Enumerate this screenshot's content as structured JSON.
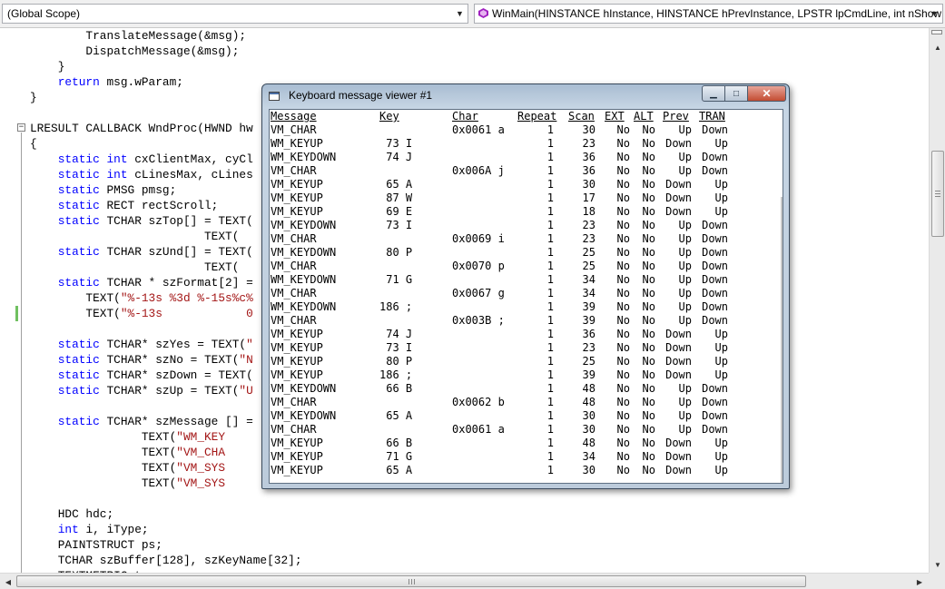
{
  "scope_bar": {
    "scope": "(Global Scope)",
    "function": "WinMain(HINSTANCE hInstance, HINSTANCE hPrevInstance, LPSTR lpCmdLine, int nShow"
  },
  "code_lines": [
    [
      {
        "t": "        TranslateMessage(&msg);"
      }
    ],
    [
      {
        "t": "        DispatchMessage(&msg);"
      }
    ],
    [
      {
        "t": "    }"
      }
    ],
    [
      {
        "t": "    "
      },
      {
        "t": "return",
        "c": "kw"
      },
      {
        "t": " msg.wParam;"
      }
    ],
    [
      {
        "t": "}"
      }
    ],
    [
      {
        "t": ""
      }
    ],
    [
      {
        "t": "LRESULT CALLBACK WndProc(HWND hw"
      }
    ],
    [
      {
        "t": "{"
      }
    ],
    [
      {
        "t": "    "
      },
      {
        "t": "static",
        "c": "kw"
      },
      {
        "t": " "
      },
      {
        "t": "int",
        "c": "kw"
      },
      {
        "t": " cxClientMax, cyCl"
      }
    ],
    [
      {
        "t": "    "
      },
      {
        "t": "static",
        "c": "kw"
      },
      {
        "t": " "
      },
      {
        "t": "int",
        "c": "kw"
      },
      {
        "t": " cLinesMax, cLines"
      }
    ],
    [
      {
        "t": "    "
      },
      {
        "t": "static",
        "c": "kw"
      },
      {
        "t": " PMSG pmsg;"
      }
    ],
    [
      {
        "t": "    "
      },
      {
        "t": "static",
        "c": "kw"
      },
      {
        "t": " RECT rectScroll;"
      }
    ],
    [
      {
        "t": "    "
      },
      {
        "t": "static",
        "c": "kw"
      },
      {
        "t": " TCHAR szTop[] = TEXT("
      }
    ],
    [
      {
        "t": "                         TEXT("
      }
    ],
    [
      {
        "t": "    "
      },
      {
        "t": "static",
        "c": "kw"
      },
      {
        "t": " TCHAR szUnd[] = TEXT("
      }
    ],
    [
      {
        "t": "                         TEXT("
      }
    ],
    [
      {
        "t": "    "
      },
      {
        "t": "static",
        "c": "kw"
      },
      {
        "t": " TCHAR * szFormat[2] ="
      }
    ],
    [
      {
        "t": "        TEXT("
      },
      {
        "t": "\"%-13s %3d %-15s%c%",
        "c": "str"
      }
    ],
    [
      {
        "t": "        TEXT("
      },
      {
        "t": "\"%-13s            0",
        "c": "str"
      }
    ],
    [
      {
        "t": ""
      }
    ],
    [
      {
        "t": "    "
      },
      {
        "t": "static",
        "c": "kw"
      },
      {
        "t": " TCHAR* szYes = TEXT("
      },
      {
        "t": "\"",
        "c": "str"
      }
    ],
    [
      {
        "t": "    "
      },
      {
        "t": "static",
        "c": "kw"
      },
      {
        "t": " TCHAR* szNo = TEXT("
      },
      {
        "t": "\"N",
        "c": "str"
      }
    ],
    [
      {
        "t": "    "
      },
      {
        "t": "static",
        "c": "kw"
      },
      {
        "t": " TCHAR* szDown = TEXT("
      }
    ],
    [
      {
        "t": "    "
      },
      {
        "t": "static",
        "c": "kw"
      },
      {
        "t": " TCHAR* szUp = TEXT("
      },
      {
        "t": "\"U",
        "c": "str"
      }
    ],
    [
      {
        "t": ""
      }
    ],
    [
      {
        "t": "    "
      },
      {
        "t": "static",
        "c": "kw"
      },
      {
        "t": " TCHAR* szMessage [] ="
      }
    ],
    [
      {
        "t": "                TEXT("
      },
      {
        "t": "\"WM_KEY",
        "c": "str"
      }
    ],
    [
      {
        "t": "                TEXT("
      },
      {
        "t": "\"VM_CHA",
        "c": "str"
      }
    ],
    [
      {
        "t": "                TEXT("
      },
      {
        "t": "\"VM_SYS",
        "c": "str"
      }
    ],
    [
      {
        "t": "                TEXT("
      },
      {
        "t": "\"VM_SYS",
        "c": "str"
      }
    ],
    [
      {
        "t": ""
      }
    ],
    [
      {
        "t": "    HDC hdc;"
      }
    ],
    [
      {
        "t": "    "
      },
      {
        "t": "int",
        "c": "kw"
      },
      {
        "t": " i, iType;"
      }
    ],
    [
      {
        "t": "    PAINTSTRUCT ps;"
      }
    ],
    [
      {
        "t": "    TCHAR szBuffer[128], szKeyName[32];"
      }
    ],
    [
      {
        "t": "    TEXTMETRIC tm;"
      }
    ]
  ],
  "viewer": {
    "title": "Keyboard message viewer #1",
    "columns": [
      "Message",
      "Key",
      "Char",
      "Repeat",
      "Scan",
      "EXT",
      "ALT",
      "Prev",
      "TRAN"
    ],
    "rows": [
      [
        "VM_CHAR",
        "",
        "0x0061 a",
        "1",
        "30",
        "No",
        "No",
        "Up",
        "Down"
      ],
      [
        "WM_KEYUP",
        " 73 I",
        "",
        "1",
        "23",
        "No",
        "No",
        "Down",
        "Up"
      ],
      [
        "WM_KEYDOWN",
        " 74 J",
        "",
        "1",
        "36",
        "No",
        "No",
        "Up",
        "Down"
      ],
      [
        "VM_CHAR",
        "",
        "0x006A j",
        "1",
        "36",
        "No",
        "No",
        "Up",
        "Down"
      ],
      [
        "VM_KEYUP",
        " 65 A",
        "",
        "1",
        "30",
        "No",
        "No",
        "Down",
        "Up"
      ],
      [
        "VM_KEYUP",
        " 87 W",
        "",
        "1",
        "17",
        "No",
        "No",
        "Down",
        "Up"
      ],
      [
        "VM_KEYUP",
        " 69 E",
        "",
        "1",
        "18",
        "No",
        "No",
        "Down",
        "Up"
      ],
      [
        "VM_KEYDOWN",
        " 73 I",
        "",
        "1",
        "23",
        "No",
        "No",
        "Up",
        "Down"
      ],
      [
        "VM_CHAR",
        "",
        "0x0069 i",
        "1",
        "23",
        "No",
        "No",
        "Up",
        "Down"
      ],
      [
        "VM_KEYDOWN",
        " 80 P",
        "",
        "1",
        "25",
        "No",
        "No",
        "Up",
        "Down"
      ],
      [
        "VM_CHAR",
        "",
        "0x0070 p",
        "1",
        "25",
        "No",
        "No",
        "Up",
        "Down"
      ],
      [
        "WM_KEYDOWN",
        " 71 G",
        "",
        "1",
        "34",
        "No",
        "No",
        "Up",
        "Down"
      ],
      [
        "VM_CHAR",
        "",
        "0x0067 g",
        "1",
        "34",
        "No",
        "No",
        "Up",
        "Down"
      ],
      [
        "WM_KEYDOWN",
        "186 ;",
        "",
        "1",
        "39",
        "No",
        "No",
        "Up",
        "Down"
      ],
      [
        "VM_CHAR",
        "",
        "0x003B ;",
        "1",
        "39",
        "No",
        "No",
        "Up",
        "Down"
      ],
      [
        "VM_KEYUP",
        " 74 J",
        "",
        "1",
        "36",
        "No",
        "No",
        "Down",
        "Up"
      ],
      [
        "VM_KEYUP",
        " 73 I",
        "",
        "1",
        "23",
        "No",
        "No",
        "Down",
        "Up"
      ],
      [
        "VM_KEYUP",
        " 80 P",
        "",
        "1",
        "25",
        "No",
        "No",
        "Down",
        "Up"
      ],
      [
        "VM_KEYUP",
        "186 ;",
        "",
        "1",
        "39",
        "No",
        "No",
        "Down",
        "Up"
      ],
      [
        "VM_KEYDOWN",
        " 66 B",
        "",
        "1",
        "48",
        "No",
        "No",
        "Up",
        "Down"
      ],
      [
        "VM_CHAR",
        "",
        "0x0062 b",
        "1",
        "48",
        "No",
        "No",
        "Up",
        "Down"
      ],
      [
        "VM_KEYDOWN",
        " 65 A",
        "",
        "1",
        "30",
        "No",
        "No",
        "Up",
        "Down"
      ],
      [
        "VM_CHAR",
        "",
        "0x0061 a",
        "1",
        "30",
        "No",
        "No",
        "Up",
        "Down"
      ],
      [
        "VM_KEYUP",
        " 66 B",
        "",
        "1",
        "48",
        "No",
        "No",
        "Down",
        "Up"
      ],
      [
        "VM_KEYUP",
        " 71 G",
        "",
        "1",
        "34",
        "No",
        "No",
        "Down",
        "Up"
      ],
      [
        "VM_KEYUP",
        " 65 A",
        "",
        "1",
        "30",
        "No",
        "No",
        "Down",
        "Up"
      ]
    ]
  },
  "icons": {
    "combo_arrow": "▼",
    "scroll_up": "▲",
    "scroll_down": "▼",
    "scroll_left": "◀",
    "scroll_right": "▶",
    "minimize": "▁",
    "maximize": "□",
    "close": "✕"
  },
  "colors": {
    "keyword": "#0000ff",
    "string": "#a31515",
    "function_icon": "#a020c0"
  }
}
